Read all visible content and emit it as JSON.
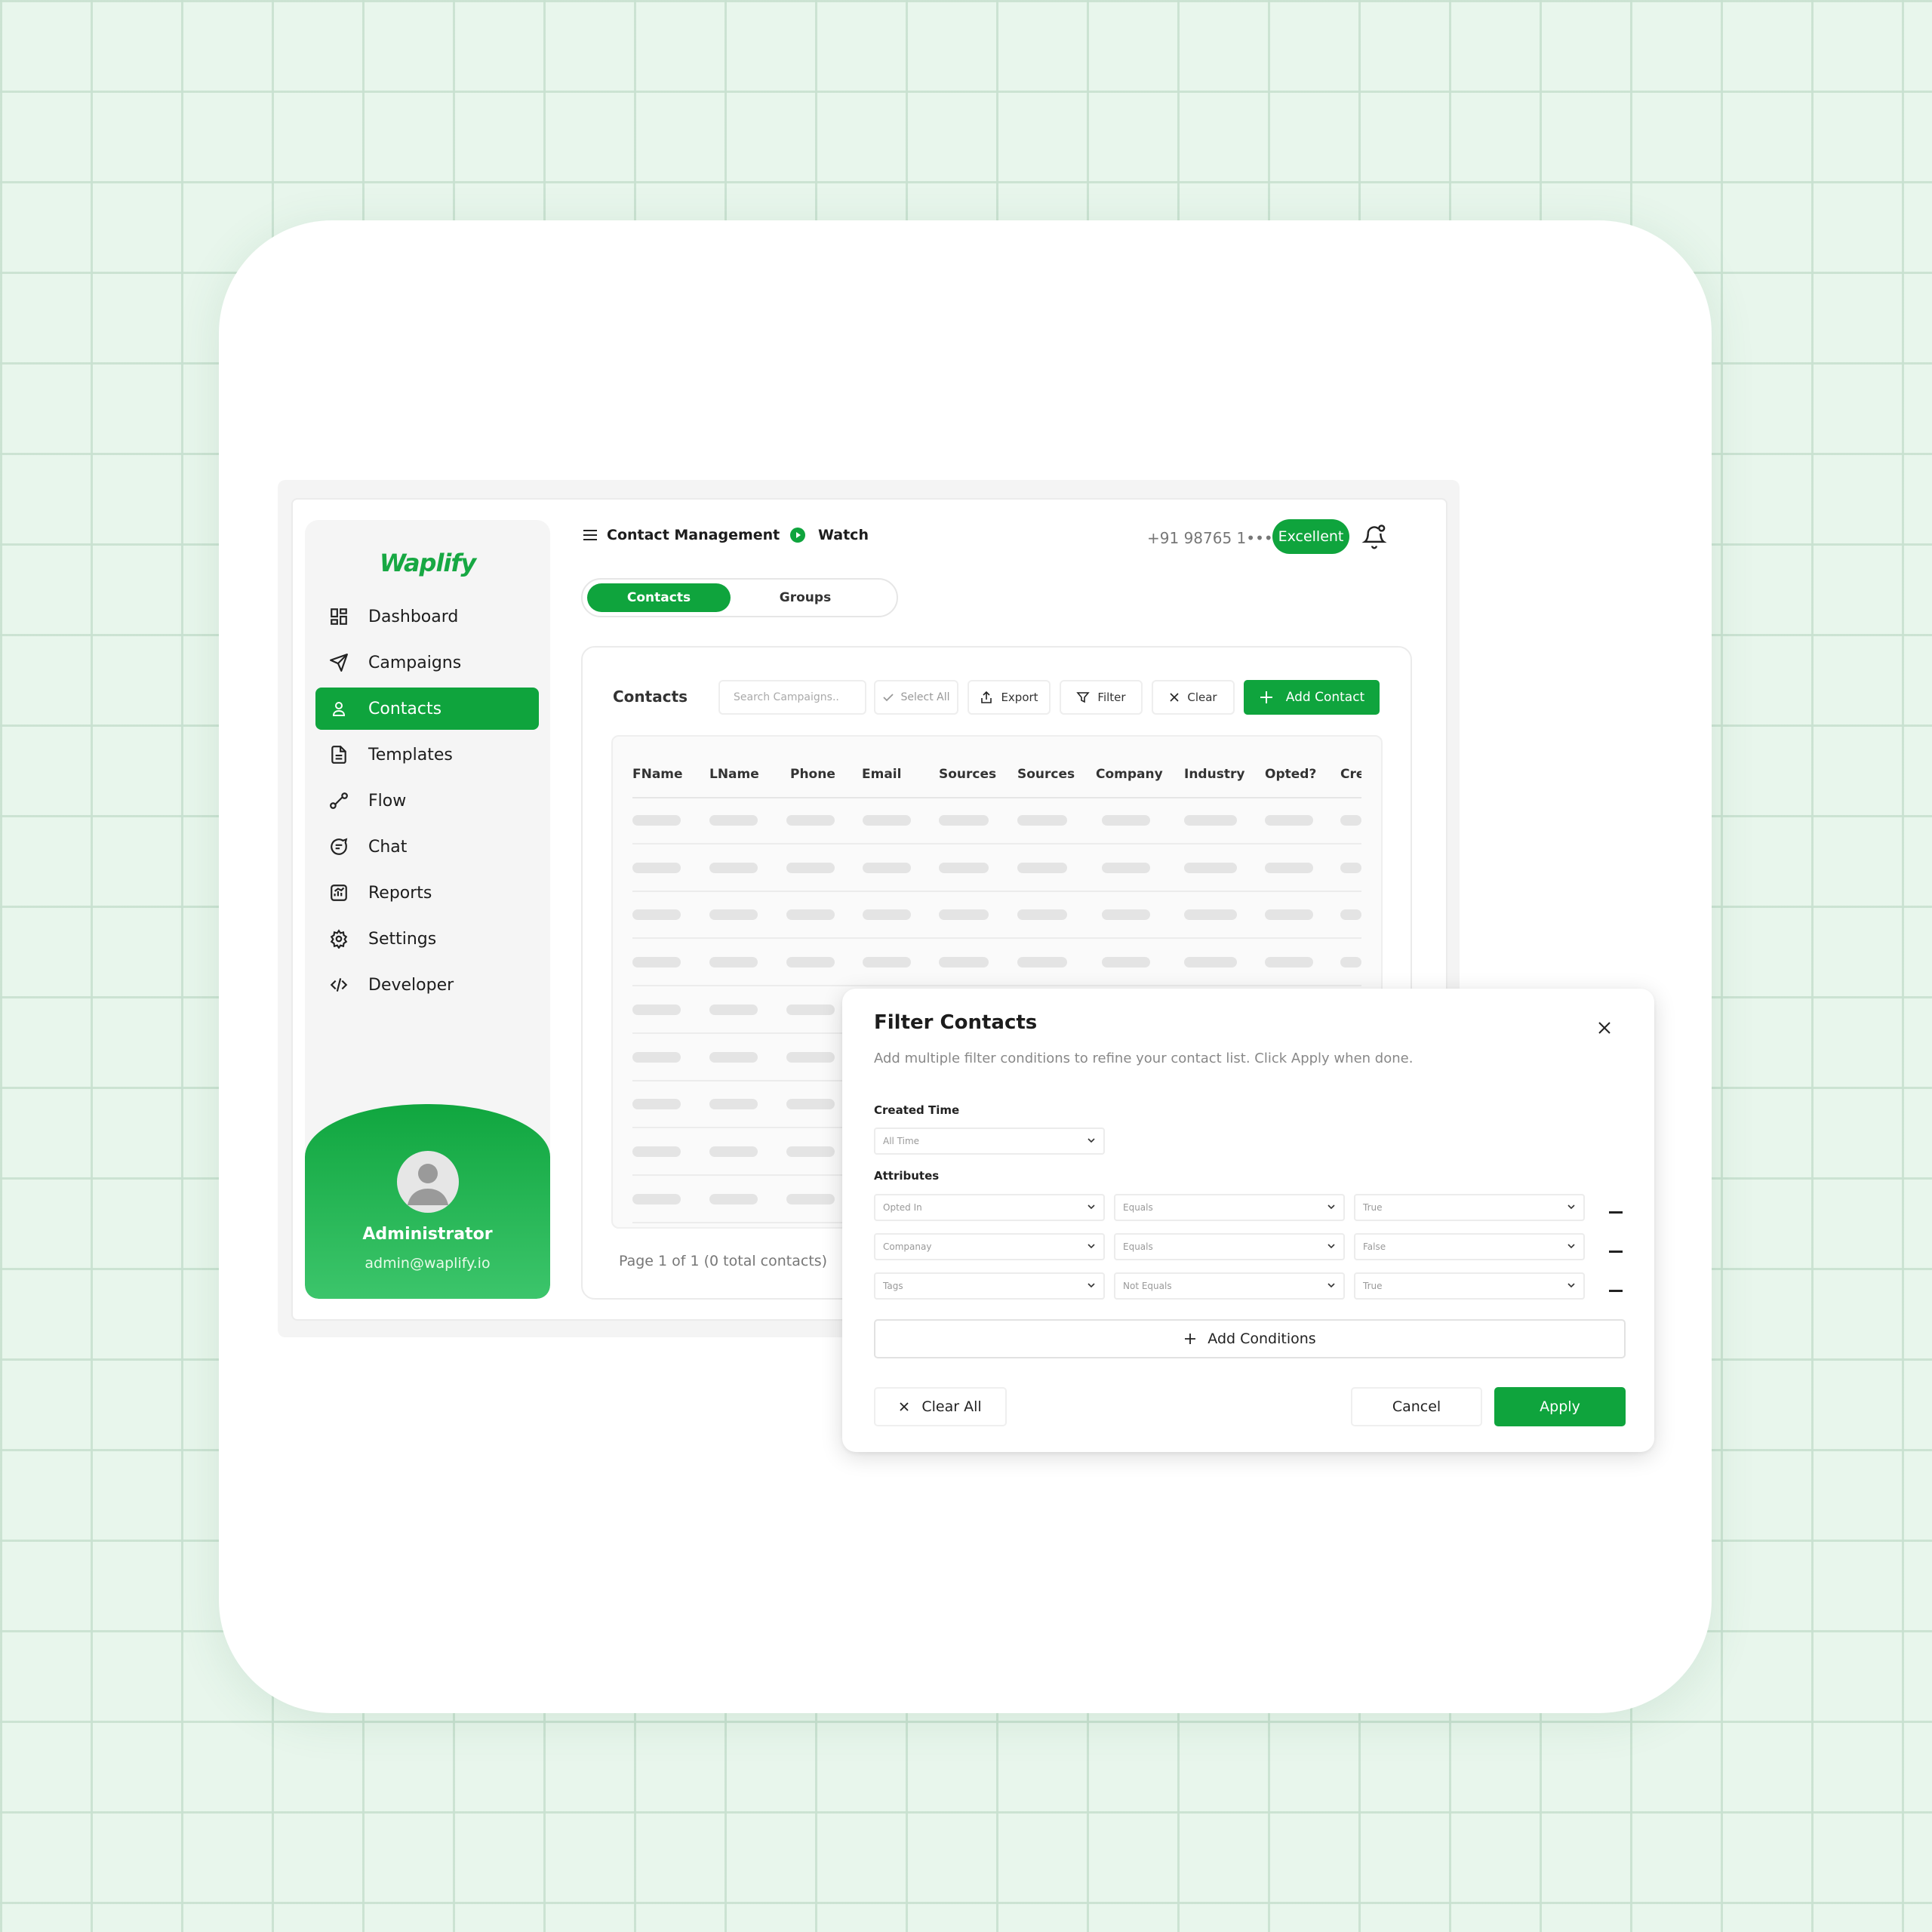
{
  "app": {
    "brand": "Waplify",
    "accent_color": "#0fa43d"
  },
  "sidebar": {
    "items": [
      {
        "label": "Dashboard",
        "icon": "dashboard-icon"
      },
      {
        "label": "Campaigns",
        "icon": "send-icon"
      },
      {
        "label": "Contacts",
        "icon": "user-icon",
        "active": true
      },
      {
        "label": "Templates",
        "icon": "document-icon"
      },
      {
        "label": "Flow",
        "icon": "flow-icon"
      },
      {
        "label": "Chat",
        "icon": "chat-icon"
      },
      {
        "label": "Reports",
        "icon": "reports-icon"
      },
      {
        "label": "Settings",
        "icon": "gear-icon"
      },
      {
        "label": "Developer",
        "icon": "code-icon"
      }
    ],
    "profile": {
      "name": "Administrator",
      "email": "admin@waplify.io"
    }
  },
  "header": {
    "title": "Contact Management",
    "watch_label": "Watch",
    "phone": "+91 98765 1••••",
    "status_badge": "Excellent"
  },
  "tabs": [
    {
      "label": "Contacts",
      "selected": true
    },
    {
      "label": "Groups",
      "selected": false
    }
  ],
  "contacts_panel": {
    "title": "Contacts",
    "search_placeholder": "Search Campaigns..",
    "toolbar": {
      "select_all": "Select All",
      "export": "Export",
      "filter": "Filter",
      "clear": "Clear",
      "add_contact": "Add Contact"
    },
    "columns": [
      "FName",
      "LName",
      "Phone",
      "Email",
      "Sources",
      "Sources",
      "Company",
      "Industry",
      "Opted?",
      "Cre"
    ],
    "pager": "Page 1 of 1 (0 total contacts)"
  },
  "filter_modal": {
    "title": "Filter Contacts",
    "subtitle": "Add multiple filter conditions to refine your contact list. Click Apply when done.",
    "created_time_label": "Created Time",
    "created_time_value": "All Time",
    "attributes_label": "Attributes",
    "conditions": [
      {
        "field": "Opted In",
        "operator": "Equals",
        "value": "True"
      },
      {
        "field": "Companay",
        "operator": "Equals",
        "value": "False"
      },
      {
        "field": "Tags",
        "operator": "Not Equals",
        "value": "True"
      }
    ],
    "add_conditions": "Add Conditions",
    "clear_all": "Clear All",
    "cancel": "Cancel",
    "apply": "Apply"
  }
}
